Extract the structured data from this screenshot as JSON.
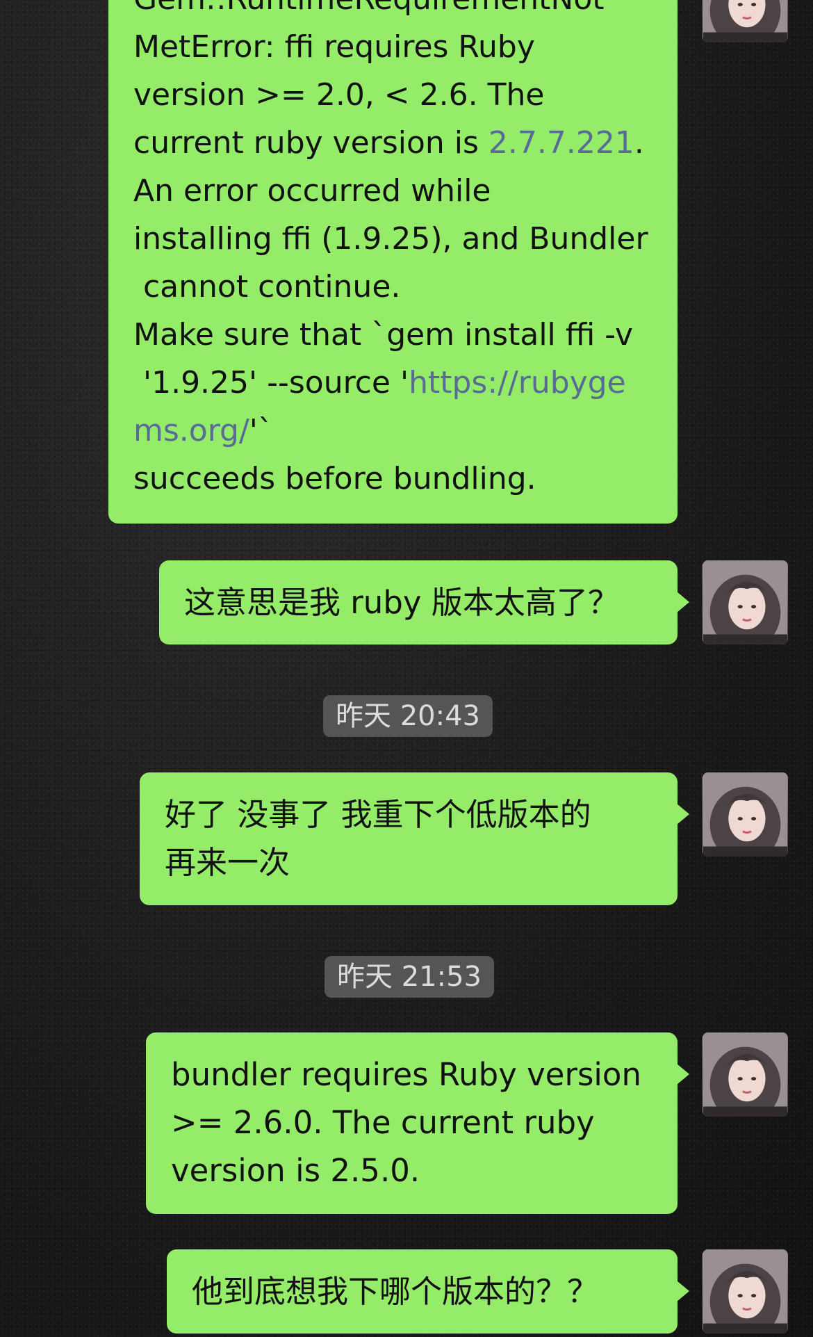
{
  "messages": [
    {
      "lines": [
        [
          {
            "t": "Gem::RuntimeRequirementNot"
          }
        ],
        [
          {
            "t": "MetError: ffi requires Ruby"
          }
        ],
        [
          {
            "t": "version >= 2.0, < 2.6. The"
          }
        ],
        [
          {
            "t": "current ruby version is "
          },
          {
            "t": "2.7.7.221",
            "link": true
          },
          {
            "t": "."
          }
        ],
        [
          {
            "t": "An error occurred while"
          }
        ],
        [
          {
            "t": "installing ffi (1.9.25), and Bundler"
          }
        ],
        [
          {
            "t": " cannot continue."
          }
        ],
        [
          {
            "t": "Make sure that `gem install ffi -v"
          }
        ],
        [
          {
            "t": " '1.9.25' --source '"
          },
          {
            "t": "https://rubyge",
            "link": true
          }
        ],
        [
          {
            "t": "ms.org/",
            "link": true
          },
          {
            "t": "'`"
          }
        ],
        [
          {
            "t": "succeeds before bundling."
          }
        ]
      ]
    },
    {
      "lines": [
        [
          {
            "t": "这意思是我 ruby 版本太高了？"
          }
        ]
      ]
    },
    {
      "lines": [
        [
          {
            "t": "好了 没事了 我重下个低版本的"
          }
        ],
        [
          {
            "t": "再来一次"
          }
        ]
      ]
    },
    {
      "lines": [
        [
          {
            "t": "bundler requires Ruby version"
          }
        ],
        [
          {
            "t": ">= 2.6.0. The current ruby"
          }
        ],
        [
          {
            "t": "version is 2.5.0."
          }
        ]
      ]
    },
    {
      "lines": [
        [
          {
            "t": "他到底想我下哪个版本的？？"
          }
        ]
      ]
    }
  ],
  "timestamps": [
    "昨天 20:43",
    "昨天 21:53"
  ],
  "avatar": {
    "icon": "user-avatar-icon"
  },
  "colors": {
    "bubble": "#95ec69",
    "link": "#576b95",
    "timestamp_bg": "#555555"
  }
}
